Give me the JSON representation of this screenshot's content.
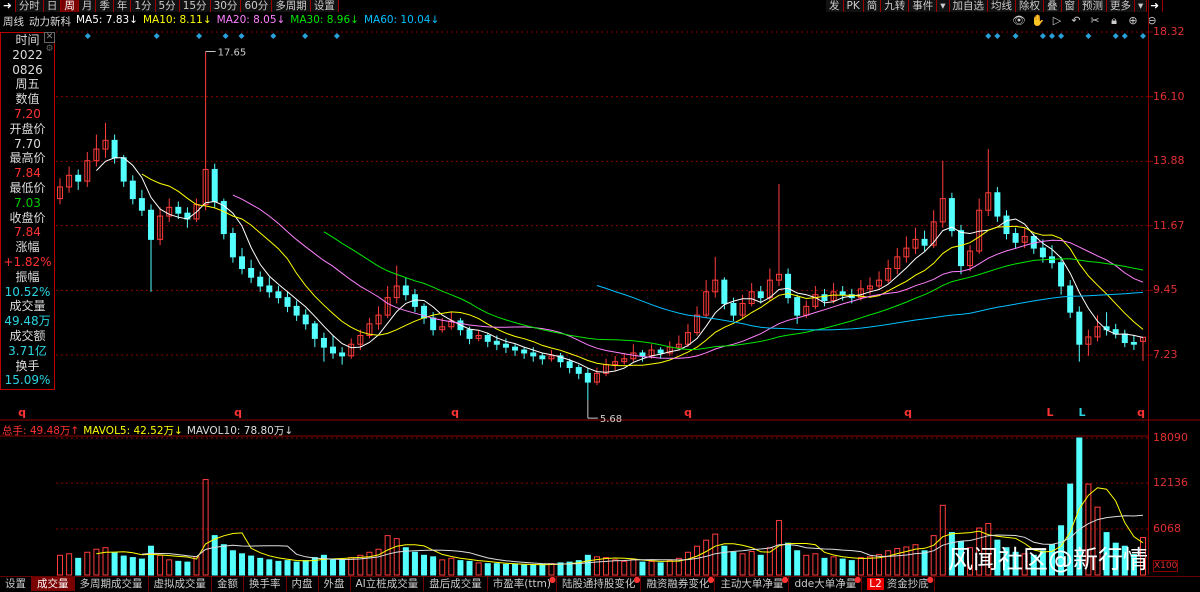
{
  "toolbar": {
    "left": [
      "分时",
      "日",
      "周",
      "月",
      "季",
      "年",
      "1分",
      "5分",
      "15分",
      "30分",
      "60分",
      "多周期",
      "设置"
    ],
    "active": "周",
    "right": [
      "发",
      "PK",
      "简",
      "九转",
      "事件",
      "▾",
      "加自选",
      "均线",
      "除权",
      "叠",
      "窗",
      "预测",
      "更多",
      "▾"
    ]
  },
  "legend": {
    "period": "周线",
    "name": "动力新科",
    "ma5": "MA5: 7.83↓",
    "ma10": "MA10: 8.11↓",
    "ma20": "MA20: 8.05↓",
    "ma30": "MA30: 8.96↓",
    "ma60": "MA60: 10.04↓"
  },
  "tools": [
    "eye-icon",
    "hand-icon",
    "play-icon",
    "undo-icon",
    "scissors-icon",
    "lock-icon",
    "zoom-in-icon",
    "zoom-out-icon"
  ],
  "info": {
    "time_label": "时间",
    "year": "2022",
    "date": "0826",
    "weekday": "周五",
    "value_label": "数值",
    "value": "7.20",
    "open_label": "开盘价",
    "open": "7.70",
    "high_label": "最高价",
    "high": "7.84",
    "low_label": "最低价",
    "low": "7.03",
    "close_label": "收盘价",
    "close": "7.84",
    "change_label": "涨幅",
    "change": "+1.82%",
    "amp_label": "振幅",
    "amp": "10.52%",
    "vol_label": "成交量",
    "vol": "49.48万",
    "amount_label": "成交额",
    "amount": "3.71亿",
    "turnover_label": "换手",
    "turnover": "15.09%"
  },
  "volume_header": {
    "total": "总手: 49.48万↑",
    "mavol5": "MAVOL5: 42.52万↓",
    "mavol10": "MAVOL10: 78.80万↓"
  },
  "tabs": [
    "设置",
    "成交量",
    "多周期成交量",
    "虚拟成交量",
    "金额",
    "换手率",
    "内盘",
    "外盘",
    "AI立桩成交量",
    "盘后成交量",
    "市盈率(ttm)",
    "陆股通持股变化",
    "融资融券变化",
    "主动大单净量",
    "dde大单净量",
    "资金抄底"
  ],
  "tabs_active": "成交量",
  "tab_badge": "L2",
  "watermark": "风闻社区@新行情",
  "colors": {
    "up": "#ff3c3c",
    "down": "#54ffff",
    "ma5": "#ffffff",
    "ma10": "#ffff00",
    "ma20": "#ff80ff",
    "ma30": "#00e600",
    "ma60": "#00c0ff",
    "grid": "#8b0000"
  },
  "markers": {
    "q": "q",
    "L": "L"
  },
  "chart_data": {
    "type": "candlestick",
    "price_axis": {
      "ticks": [
        "18.32",
        "16.10",
        "13.88",
        "11.67",
        "9.45",
        "7.23"
      ],
      "range": [
        7.23,
        18.32
      ]
    },
    "volume_axis": {
      "ticks": [
        "18090",
        "12136",
        "6068"
      ],
      "unit": "X100",
      "range": [
        0,
        18090
      ]
    },
    "annotations": {
      "max": "17.65",
      "min": "5.68"
    },
    "ma_periods": [
      5,
      10,
      20,
      30,
      60
    ],
    "mavol_periods": [
      5,
      10
    ],
    "bars": [
      [
        12.6,
        13.3,
        12.4,
        13.0,
        2600
      ],
      [
        13.0,
        13.7,
        12.8,
        13.4,
        2800
      ],
      [
        13.4,
        13.6,
        12.9,
        13.2,
        2200
      ],
      [
        13.2,
        14.2,
        13.0,
        13.9,
        3000
      ],
      [
        13.9,
        14.8,
        13.7,
        14.3,
        3400
      ],
      [
        14.3,
        15.2,
        14.0,
        14.6,
        3600
      ],
      [
        14.6,
        14.8,
        13.8,
        14.0,
        2900
      ],
      [
        14.0,
        14.1,
        13.0,
        13.2,
        2500
      ],
      [
        13.2,
        13.4,
        12.4,
        12.6,
        2300
      ],
      [
        12.6,
        12.9,
        12.0,
        12.2,
        2100
      ],
      [
        12.2,
        12.4,
        9.4,
        11.2,
        3800
      ],
      [
        11.2,
        12.3,
        11.0,
        12.0,
        2600
      ],
      [
        12.0,
        12.6,
        11.8,
        12.3,
        2000
      ],
      [
        12.3,
        12.5,
        11.9,
        12.1,
        1800
      ],
      [
        12.1,
        12.3,
        11.6,
        11.9,
        1700
      ],
      [
        11.9,
        12.6,
        11.8,
        12.4,
        2400
      ],
      [
        12.4,
        17.65,
        12.2,
        13.6,
        12600
      ],
      [
        13.6,
        13.8,
        12.3,
        12.5,
        5200
      ],
      [
        12.5,
        12.6,
        11.2,
        11.4,
        4000
      ],
      [
        11.4,
        11.6,
        10.4,
        10.6,
        3200
      ],
      [
        10.6,
        10.9,
        10.0,
        10.2,
        2800
      ],
      [
        10.2,
        10.5,
        9.7,
        9.9,
        2500
      ],
      [
        9.9,
        10.1,
        9.4,
        9.6,
        2200
      ],
      [
        9.6,
        9.9,
        9.2,
        9.4,
        2000
      ],
      [
        9.4,
        9.6,
        9.0,
        9.2,
        1800
      ],
      [
        9.2,
        9.4,
        8.7,
        8.9,
        1900
      ],
      [
        8.9,
        9.1,
        8.4,
        8.6,
        1700
      ],
      [
        8.6,
        8.8,
        8.1,
        8.3,
        1900
      ],
      [
        8.3,
        8.4,
        7.5,
        7.8,
        2300
      ],
      [
        7.8,
        8.0,
        7.0,
        7.5,
        2600
      ],
      [
        7.5,
        7.9,
        7.1,
        7.3,
        2100
      ],
      [
        7.3,
        7.5,
        6.9,
        7.2,
        2000
      ],
      [
        7.2,
        7.8,
        7.1,
        7.6,
        2300
      ],
      [
        7.6,
        8.1,
        7.4,
        7.9,
        2600
      ],
      [
        7.9,
        8.5,
        7.8,
        8.3,
        3000
      ],
      [
        8.3,
        8.9,
        8.1,
        8.6,
        3400
      ],
      [
        8.6,
        9.6,
        8.5,
        9.2,
        5200
      ],
      [
        9.2,
        10.3,
        9.0,
        9.6,
        4800
      ],
      [
        9.6,
        9.9,
        9.1,
        9.3,
        3600
      ],
      [
        9.3,
        9.5,
        8.7,
        8.9,
        3000
      ],
      [
        8.9,
        9.0,
        8.3,
        8.5,
        2600
      ],
      [
        8.5,
        8.7,
        7.9,
        8.1,
        2400
      ],
      [
        8.1,
        8.5,
        8.0,
        8.2,
        2000
      ],
      [
        8.2,
        8.7,
        8.1,
        8.4,
        2200
      ],
      [
        8.4,
        8.5,
        7.9,
        8.1,
        1900
      ],
      [
        8.1,
        8.2,
        7.6,
        7.8,
        1800
      ],
      [
        7.8,
        8.1,
        7.7,
        7.9,
        1600
      ],
      [
        7.9,
        8.0,
        7.5,
        7.7,
        1500
      ],
      [
        7.7,
        7.9,
        7.4,
        7.6,
        1500
      ],
      [
        7.6,
        7.8,
        7.3,
        7.5,
        1400
      ],
      [
        7.5,
        7.6,
        7.2,
        7.4,
        1400
      ],
      [
        7.4,
        7.5,
        7.1,
        7.3,
        1300
      ],
      [
        7.3,
        7.5,
        7.0,
        7.2,
        1300
      ],
      [
        7.2,
        7.3,
        6.9,
        7.1,
        1400
      ],
      [
        7.1,
        7.4,
        7.0,
        7.2,
        1500
      ],
      [
        7.2,
        7.3,
        6.8,
        7.0,
        1600
      ],
      [
        7.0,
        7.1,
        6.6,
        6.8,
        1700
      ],
      [
        6.8,
        6.9,
        6.4,
        6.6,
        1900
      ],
      [
        6.6,
        6.8,
        5.68,
        6.3,
        2600
      ],
      [
        6.3,
        6.8,
        6.2,
        6.6,
        2400
      ],
      [
        6.6,
        7.1,
        6.5,
        6.9,
        2300
      ],
      [
        6.9,
        7.2,
        6.7,
        7.0,
        2000
      ],
      [
        7.0,
        7.3,
        6.9,
        7.1,
        1800
      ],
      [
        7.1,
        7.6,
        7.0,
        7.3,
        2100
      ],
      [
        7.3,
        7.4,
        7.0,
        7.2,
        1700
      ],
      [
        7.2,
        7.6,
        7.1,
        7.4,
        1800
      ],
      [
        7.4,
        7.5,
        7.1,
        7.3,
        1600
      ],
      [
        7.3,
        7.7,
        7.2,
        7.5,
        1900
      ],
      [
        7.5,
        7.9,
        7.4,
        7.6,
        2200
      ],
      [
        7.6,
        8.3,
        7.5,
        8.0,
        3000
      ],
      [
        8.0,
        8.9,
        7.9,
        8.6,
        3800
      ],
      [
        8.6,
        9.8,
        8.5,
        9.4,
        4600
      ],
      [
        9.4,
        10.6,
        9.2,
        9.8,
        5400
      ],
      [
        9.8,
        9.9,
        8.8,
        9.0,
        3800
      ],
      [
        9.0,
        9.2,
        8.4,
        8.6,
        3000
      ],
      [
        8.6,
        9.3,
        8.5,
        9.0,
        2800
      ],
      [
        9.0,
        9.7,
        8.9,
        9.4,
        3100
      ],
      [
        9.4,
        9.6,
        9.0,
        9.2,
        2600
      ],
      [
        9.2,
        10.2,
        9.1,
        9.8,
        3600
      ],
      [
        9.8,
        13.1,
        9.6,
        10.0,
        7200
      ],
      [
        10.0,
        10.2,
        9.0,
        9.2,
        4200
      ],
      [
        9.2,
        9.3,
        8.3,
        8.6,
        3200
      ],
      [
        8.6,
        9.1,
        8.5,
        8.9,
        2600
      ],
      [
        8.9,
        9.6,
        8.8,
        9.3,
        2800
      ],
      [
        9.3,
        9.5,
        8.9,
        9.1,
        2200
      ],
      [
        9.1,
        9.7,
        9.0,
        9.4,
        2400
      ],
      [
        9.4,
        9.6,
        9.1,
        9.3,
        2100
      ],
      [
        9.3,
        9.5,
        9.0,
        9.2,
        1900
      ],
      [
        9.2,
        9.8,
        9.1,
        9.5,
        2300
      ],
      [
        9.5,
        9.9,
        9.3,
        9.6,
        2400
      ],
      [
        9.6,
        10.1,
        9.5,
        9.8,
        2700
      ],
      [
        9.8,
        10.5,
        9.7,
        10.2,
        3200
      ],
      [
        10.2,
        10.9,
        10.0,
        10.6,
        3500
      ],
      [
        10.6,
        11.3,
        10.4,
        10.9,
        3700
      ],
      [
        10.9,
        11.6,
        10.7,
        11.2,
        4000
      ],
      [
        11.2,
        11.5,
        10.8,
        11.0,
        3200
      ],
      [
        11.0,
        12.2,
        10.9,
        11.8,
        5200
      ],
      [
        11.8,
        13.9,
        11.6,
        12.6,
        9200
      ],
      [
        12.6,
        12.8,
        11.3,
        11.5,
        5600
      ],
      [
        11.5,
        11.7,
        10.0,
        10.3,
        4400
      ],
      [
        10.3,
        11.0,
        10.1,
        10.8,
        3600
      ],
      [
        10.8,
        12.6,
        10.7,
        12.2,
        6200
      ],
      [
        12.2,
        14.3,
        12.0,
        12.8,
        6800
      ],
      [
        12.8,
        13.0,
        11.8,
        12.0,
        4600
      ],
      [
        12.0,
        12.2,
        11.2,
        11.4,
        3600
      ],
      [
        11.4,
        11.6,
        10.9,
        11.1,
        3000
      ],
      [
        11.1,
        11.6,
        10.9,
        11.3,
        2800
      ],
      [
        11.3,
        11.4,
        10.7,
        10.9,
        2600
      ],
      [
        10.9,
        11.2,
        10.4,
        10.6,
        3200
      ],
      [
        10.6,
        11.0,
        10.2,
        10.4,
        4000
      ],
      [
        10.4,
        10.6,
        9.3,
        9.6,
        6500
      ],
      [
        9.6,
        9.8,
        8.5,
        8.7,
        12000
      ],
      [
        8.7,
        8.9,
        7.0,
        7.6,
        18090
      ],
      [
        7.6,
        8.1,
        7.2,
        7.85,
        12000
      ],
      [
        7.85,
        8.6,
        7.7,
        8.2,
        8962
      ],
      [
        8.2,
        8.7,
        7.9,
        8.1,
        5600
      ],
      [
        8.1,
        8.3,
        7.8,
        7.95,
        4200
      ],
      [
        7.95,
        8.1,
        7.5,
        7.66,
        3800
      ],
      [
        7.66,
        7.9,
        7.4,
        7.6,
        2700
      ],
      [
        7.7,
        7.84,
        7.03,
        7.84,
        4948
      ]
    ]
  }
}
